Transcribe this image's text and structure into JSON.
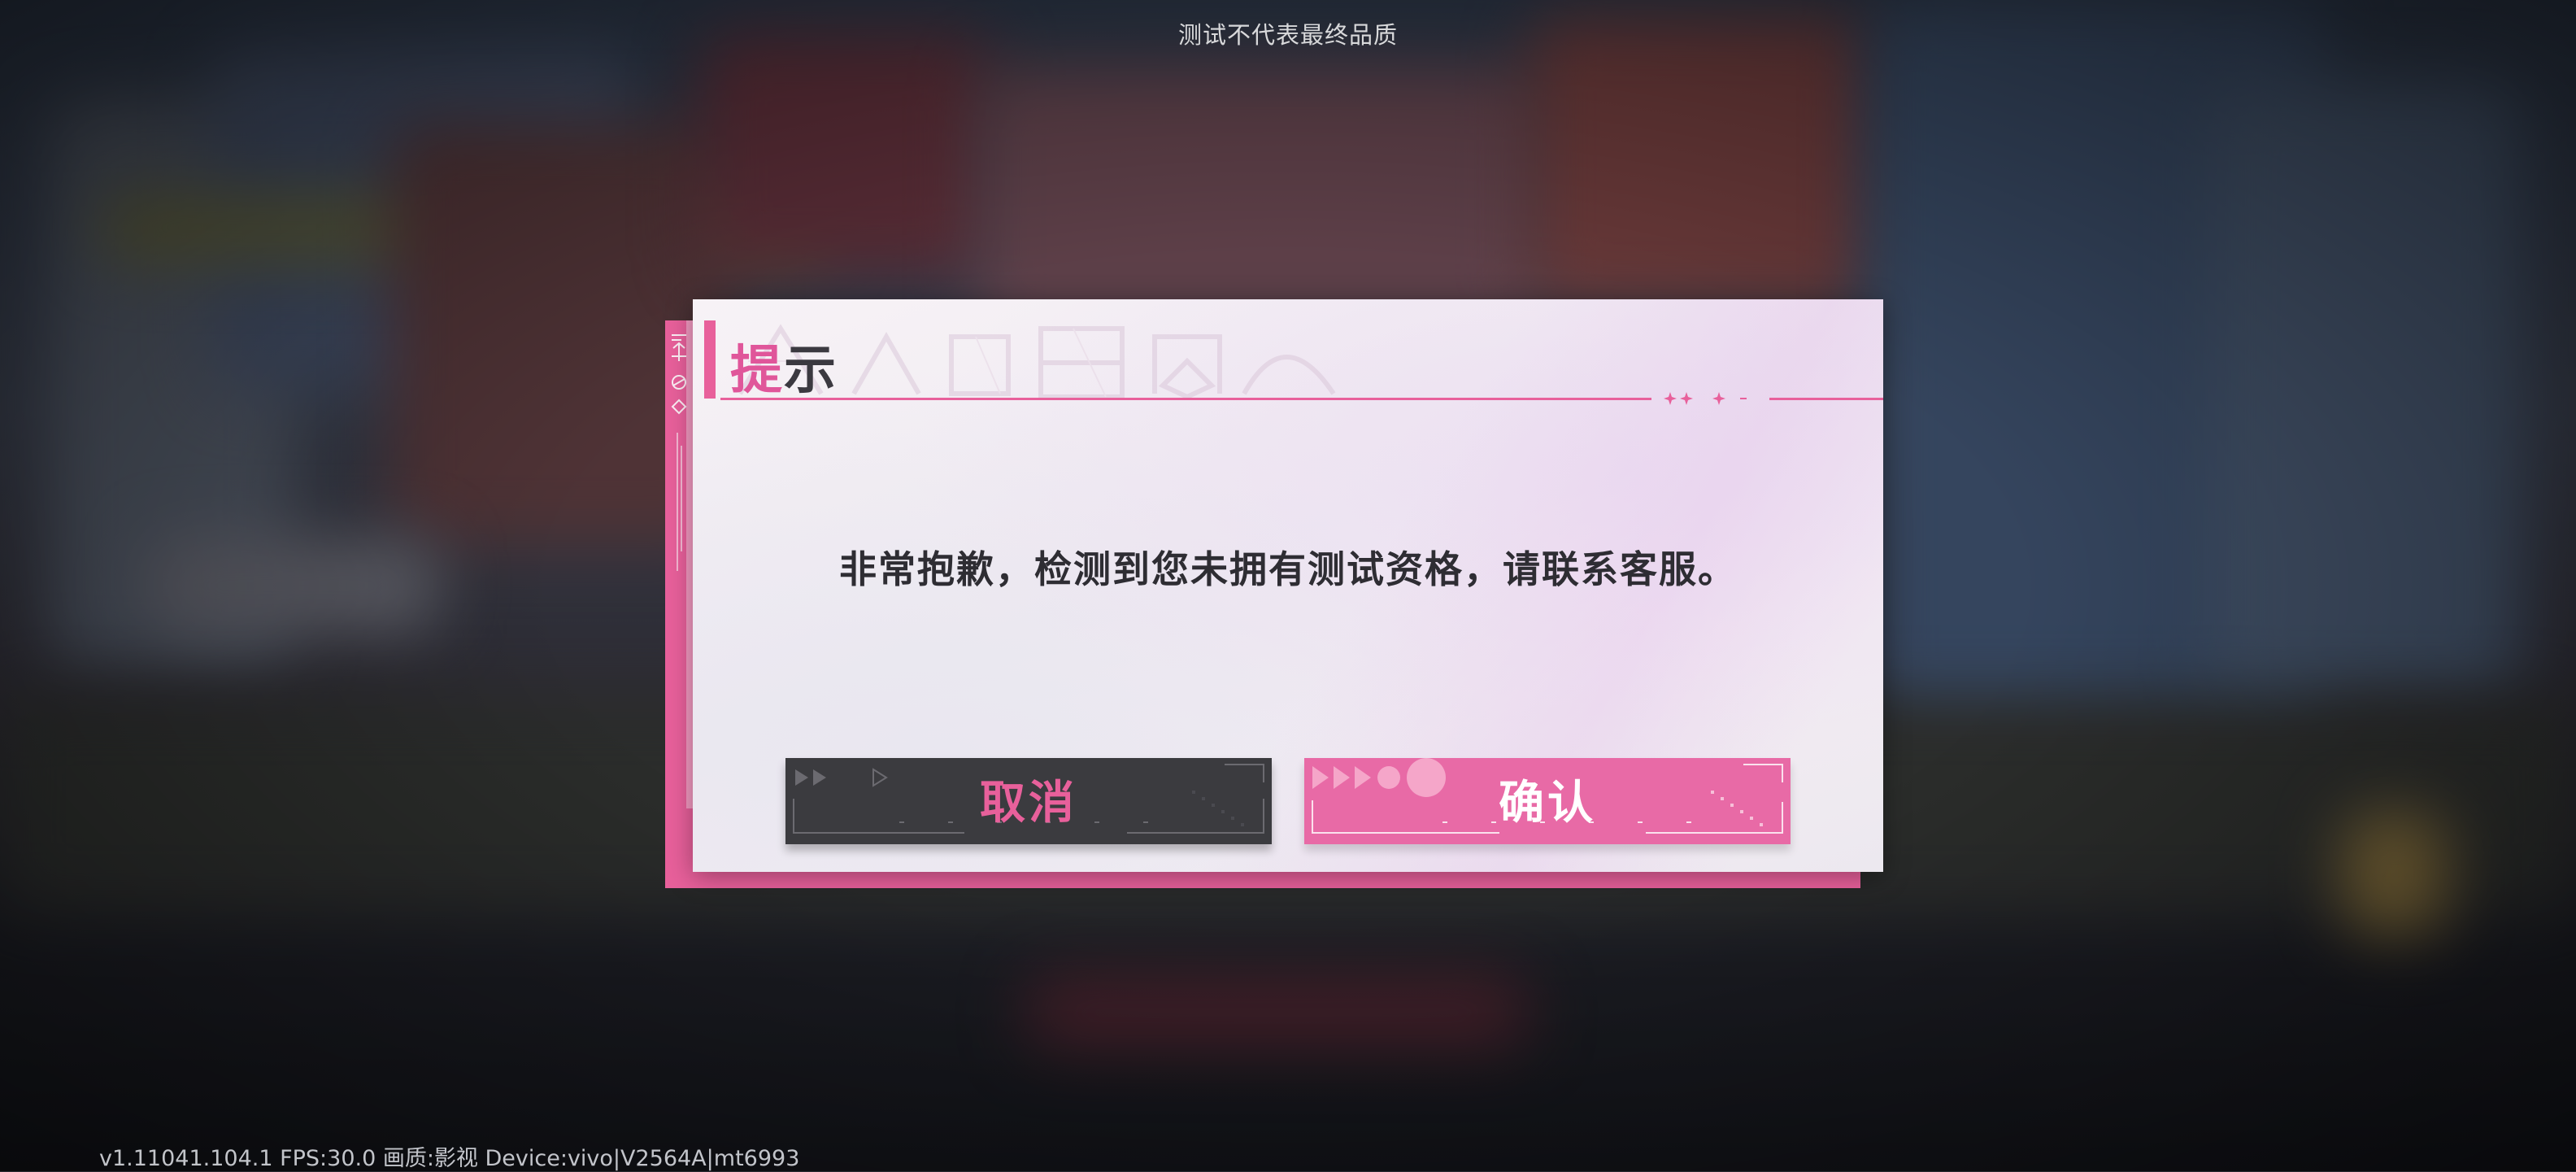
{
  "watermark": "测试不代表最终品质",
  "dialog": {
    "title_first": "提",
    "title_rest": "示",
    "message": "非常抱歉，检测到您未拥有测试资格，请联系客服。",
    "cancel_label": "取消",
    "confirm_label": "确认",
    "accent_color": "#e8609b",
    "cancel_bg": "#3b3b3f",
    "confirm_bg": "#e86aa6"
  },
  "debug_info": "v1.11041.104.1 FPS:30.0 画质:影视 Device:vivo|V2564A|mt6993",
  "icons": [
    "arrow-icon",
    "circle-icon",
    "diamond-icon",
    "triangle-icon",
    "sparkle-icon"
  ]
}
